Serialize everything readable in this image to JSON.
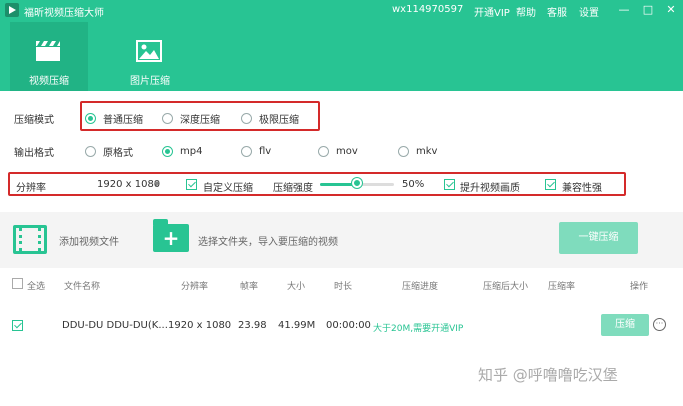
{
  "titlebar": {
    "app_title": "福昕视频压缩大师",
    "user_id": "wx114970597",
    "open_vip": "开通VIP",
    "help": "帮助",
    "service": "客服",
    "settings": "设置",
    "minimize": "—",
    "maximize": "□",
    "close": "✕"
  },
  "tabs": [
    {
      "label": "视频压缩",
      "icon": "video-clapper-icon",
      "active": true
    },
    {
      "label": "图片压缩",
      "icon": "image-icon",
      "active": false
    }
  ],
  "settings": {
    "mode_label": "压缩模式",
    "modes": [
      "普通压缩",
      "深度压缩",
      "极限压缩"
    ],
    "mode_selected": "普通压缩",
    "format_label": "输出格式",
    "formats": [
      "原格式",
      "mp4",
      "flv",
      "mov",
      "mkv"
    ],
    "format_selected": "mp4",
    "resolution_label": "分辨率",
    "resolution_value": "1920 x 1080",
    "custom_compress_label": "自定义压缩",
    "custom_compress_checked": true,
    "strength_label": "压缩强度",
    "strength_value": "50%",
    "strength_level": 0.5,
    "enhance_label": "提升视频画质",
    "enhance_checked": true,
    "compat_label": "兼容性强",
    "compat_checked": true
  },
  "add_area": {
    "add_video": "添加视频文件",
    "choose_folder": "选择文件夹，导入要压缩的视频",
    "compress_all": "一键压缩"
  },
  "table": {
    "headers": {
      "select_all": "全选",
      "filename": "文件名称",
      "resolution": "分辨率",
      "framerate": "帧率",
      "size": "大小",
      "duration": "时长",
      "progress": "压缩进度",
      "compressed_size": "压缩后大小",
      "ratio": "压缩率",
      "actions": "操作"
    },
    "rows": [
      {
        "checked": true,
        "filename": "DDU-DU DDU-DU(K...",
        "resolution": "1920 x 1080",
        "framerate": "23.98",
        "size": "41.99M",
        "duration": "00:00:00",
        "progress": "大于20M,需要开通VIP",
        "action": "压缩"
      }
    ]
  },
  "watermark": "知乎 @呼噜噜吃汉堡",
  "colors": {
    "brand": "#28c493",
    "highlight_box": "#d42a2a"
  }
}
